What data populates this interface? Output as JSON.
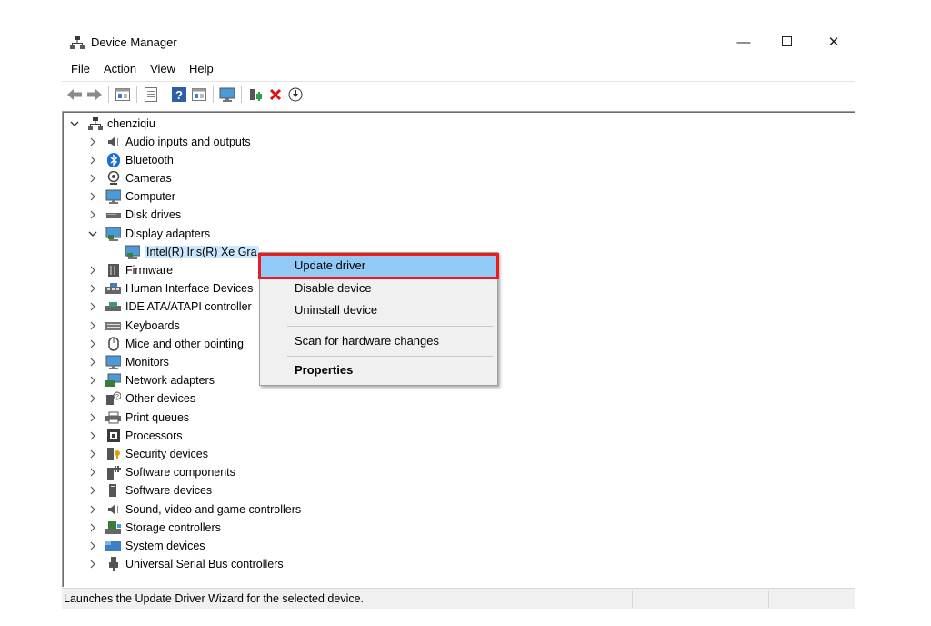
{
  "window": {
    "title": "Device Manager",
    "controls": {
      "minimize": "—",
      "maximize": "☐",
      "close": "✕"
    }
  },
  "menu": [
    "File",
    "Action",
    "View",
    "Help"
  ],
  "toolbar_icons": [
    "back-arrow-icon",
    "forward-arrow-icon",
    "properties-grid-icon",
    "page-icon",
    "help-icon",
    "grid-icon",
    "monitor-icon",
    "add-driver-icon",
    "uninstall-x-icon",
    "download-icon"
  ],
  "tree": {
    "root": "chenziqiu",
    "items": [
      {
        "label": "Audio inputs and outputs",
        "icon": "speaker-icon"
      },
      {
        "label": "Bluetooth",
        "icon": "bluetooth-icon"
      },
      {
        "label": "Cameras",
        "icon": "camera-icon"
      },
      {
        "label": "Computer",
        "icon": "computer-icon"
      },
      {
        "label": "Disk drives",
        "icon": "disk-icon"
      },
      {
        "label": "Display adapters",
        "icon": "display-icon",
        "expanded": true
      },
      {
        "label": "Intel(R) Iris(R) Xe Gra",
        "icon": "display-adapter-icon",
        "child": true
      },
      {
        "label": "Firmware",
        "icon": "chip-icon"
      },
      {
        "label": "Human Interface Devices",
        "icon": "hid-icon"
      },
      {
        "label": "IDE ATA/ATAPI controller",
        "icon": "ide-icon"
      },
      {
        "label": "Keyboards",
        "icon": "keyboard-icon"
      },
      {
        "label": "Mice and other pointing",
        "icon": "mouse-icon"
      },
      {
        "label": "Monitors",
        "icon": "monitor-icon"
      },
      {
        "label": "Network adapters",
        "icon": "network-icon"
      },
      {
        "label": "Other devices",
        "icon": "unknown-device-icon"
      },
      {
        "label": "Print queues",
        "icon": "printer-icon"
      },
      {
        "label": "Processors",
        "icon": "processor-icon"
      },
      {
        "label": "Security devices",
        "icon": "security-icon"
      },
      {
        "label": "Software components",
        "icon": "software-component-icon"
      },
      {
        "label": "Software devices",
        "icon": "software-device-icon"
      },
      {
        "label": "Sound, video and game controllers",
        "icon": "sound-icon"
      },
      {
        "label": "Storage controllers",
        "icon": "storage-icon"
      },
      {
        "label": "System devices",
        "icon": "system-icon"
      },
      {
        "label": "Universal Serial Bus controllers",
        "icon": "usb-icon"
      }
    ]
  },
  "context_menu": {
    "update_driver": "Update driver",
    "disable_device": "Disable device",
    "uninstall_device": "Uninstall device",
    "scan_hardware": "Scan for hardware changes",
    "properties": "Properties"
  },
  "status": {
    "text": "Launches the Update Driver Wizard for the selected device."
  },
  "colors": {
    "highlight": "#91c9f7",
    "callout": "#e81e1e",
    "selection": "#cce8ff"
  }
}
